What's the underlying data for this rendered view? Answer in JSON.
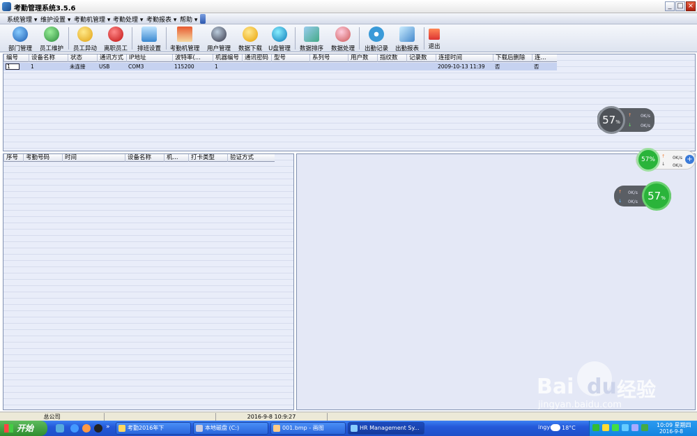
{
  "window": {
    "title": "考勤管理系统3.5.6"
  },
  "menu": [
    "系统管理 ▾",
    "维护设置 ▾",
    "考勤机管理 ▾",
    "考勤处理 ▾",
    "考勤报表 ▾",
    "帮助 ▾"
  ],
  "toolbar": [
    "部门管理",
    "员工维护",
    "员工异动",
    "离职员工",
    "排班设置",
    "考勤机管理",
    "用户管理",
    "数据下载",
    "U盘管理",
    "数据排序",
    "数据处理",
    "出勤记录",
    "出勤报表",
    "退出"
  ],
  "device_table": {
    "columns": [
      "编号",
      "设备名称",
      "状态",
      "通讯方式",
      "IP地址",
      "波特率(...",
      "机器编号",
      "通讯密码",
      "型号",
      "系列号",
      "用户数",
      "指纹数",
      "记录数",
      "连接时间",
      "下载后删除",
      "连..."
    ],
    "rows": [
      [
        "1",
        "1",
        "未连接",
        "USB",
        "COM3",
        "115200",
        "1",
        "",
        "",
        "",
        "",
        "",
        "",
        "2009-10-13 11:39",
        "否",
        "否"
      ]
    ]
  },
  "record_table": {
    "columns": [
      "序号",
      "考勤号码",
      "时间",
      "设备名称",
      "机...",
      "打卡类型",
      "验证方式"
    ]
  },
  "status": {
    "company": "总公司",
    "datetime": "2016-9-8 10:9:27"
  },
  "widgets": {
    "cpu1": "57",
    "cpu2": "57%",
    "cpu3": "57",
    "unit": "%",
    "up": "0K/s",
    "down": "0K/s"
  },
  "taskbar": {
    "start": "开始",
    "tasks": [
      "考勤2016年下",
      "本地磁盘 (C:)",
      "001.bmp - 画图",
      "HR Management Sy..."
    ],
    "weather": "18°C",
    "time": "10:09 星期四",
    "date": "2016-9-8"
  },
  "watermark": {
    "brand": "Bai",
    "brand2": "du",
    "cn": "经验",
    "url": "jingyan.baidu.com"
  },
  "colors": {
    "grid": "#e8ecf8",
    "header": "#e2e6f0",
    "selected_row": "#c6d2f0",
    "taskbar": "#2459d9",
    "widget_green": "#2ab43a"
  }
}
